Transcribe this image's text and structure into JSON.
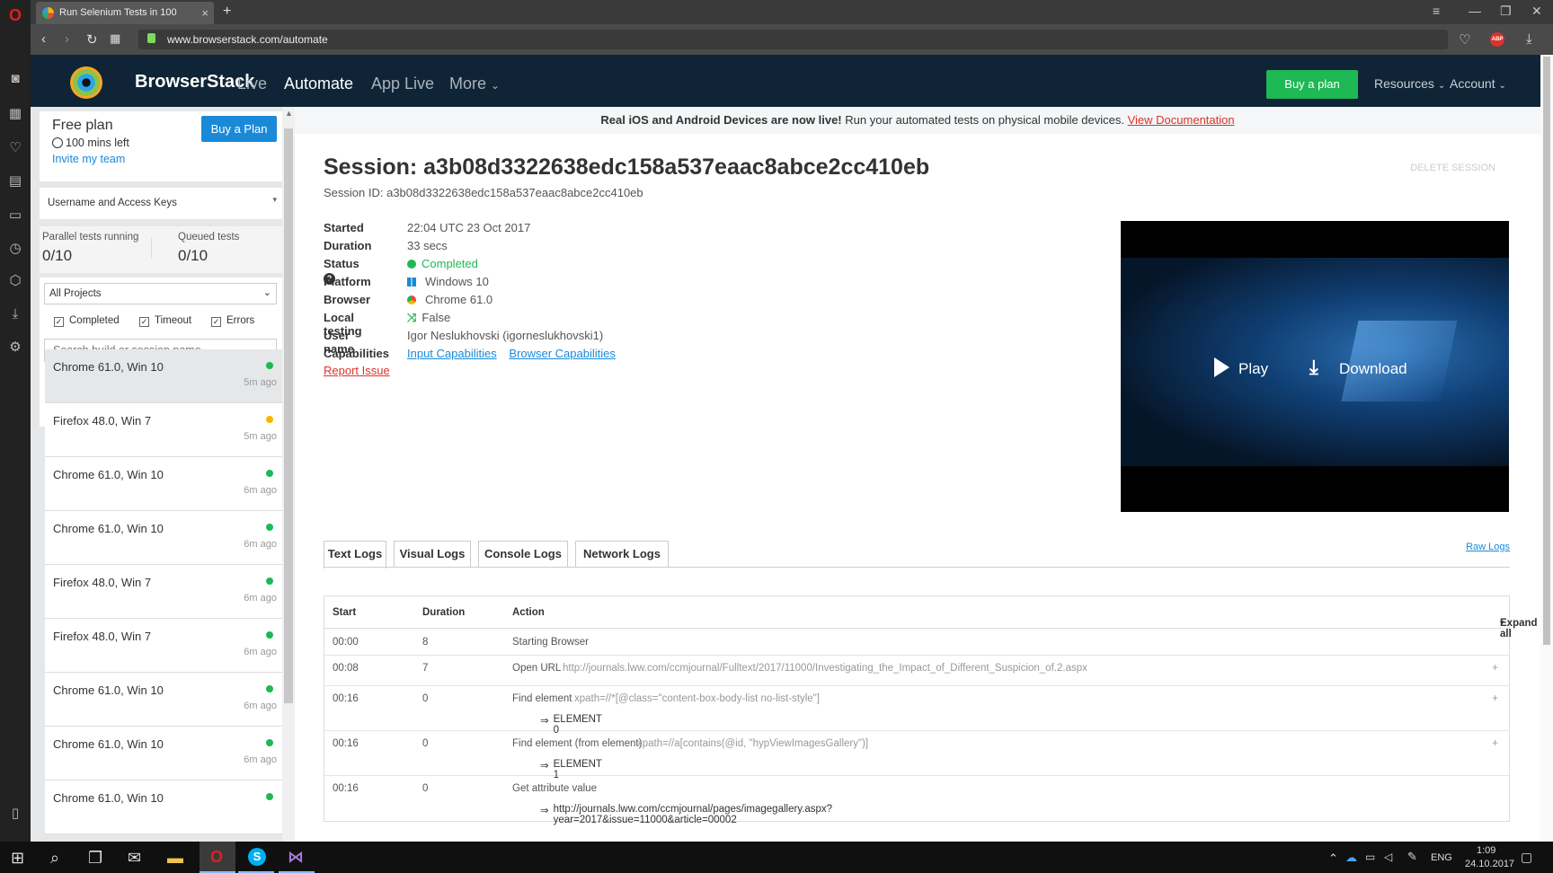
{
  "browser": {
    "tab_title": "Run Selenium Tests in 100",
    "tab_close": "×",
    "new_tab": "+",
    "url": "www.browserstack.com/automate",
    "adblock_badge": "ABP"
  },
  "site_nav": {
    "brand": "BrowserStack",
    "links": [
      "Live",
      "Automate",
      "App Live",
      "More"
    ],
    "more_chevron": "⌄",
    "buy_plan": "Buy a plan",
    "resources": "Resources",
    "account": "Account"
  },
  "sidebar": {
    "plan": {
      "title": "Free plan",
      "mins_left": "100 mins left",
      "invite": "Invite my team",
      "buy_button": "Buy a Plan"
    },
    "access_keys_label": "Username and Access Keys",
    "parallel": {
      "label": "Parallel tests running",
      "value": "0/10"
    },
    "queued": {
      "label": "Queued tests",
      "value": "0/10"
    },
    "project_filter": "All Projects",
    "filters": [
      "Completed",
      "Timeout",
      "Errors"
    ],
    "search_placeholder": "Search build or session name",
    "sessions": [
      {
        "name": "Chrome 61.0, Win 10",
        "time": "5m ago",
        "status_color": "#1eb854"
      },
      {
        "name": "Firefox 48.0, Win 7",
        "time": "5m ago",
        "status_color": "#f5b800"
      },
      {
        "name": "Chrome 61.0, Win 10",
        "time": "6m ago",
        "status_color": "#1eb854"
      },
      {
        "name": "Chrome 61.0, Win 10",
        "time": "6m ago",
        "status_color": "#1eb854"
      },
      {
        "name": "Firefox 48.0, Win 7",
        "time": "6m ago",
        "status_color": "#1eb854"
      },
      {
        "name": "Firefox 48.0, Win 7",
        "time": "6m ago",
        "status_color": "#1eb854"
      },
      {
        "name": "Chrome 61.0, Win 10",
        "time": "6m ago",
        "status_color": "#1eb854"
      },
      {
        "name": "Chrome 61.0, Win 10",
        "time": "6m ago",
        "status_color": "#1eb854"
      },
      {
        "name": "Chrome 61.0, Win 10",
        "time": "",
        "status_color": "#1eb854"
      }
    ]
  },
  "banner": {
    "bold": "Real iOS and Android Devices are now live!",
    "text": "Run your automated tests on physical mobile devices.",
    "link": "View Documentation"
  },
  "session": {
    "title": "Session: a3b08d3322638edc158a537eaac8abce2cc410eb",
    "id_line": "Session ID: a3b08d3322638edc158a537eaac8abce2cc410eb",
    "delete": "DELETE SESSION",
    "rows": [
      {
        "key": "Started",
        "value": "22:04 UTC 23 Oct 2017"
      },
      {
        "key": "Duration",
        "value": "33 secs"
      },
      {
        "key": "Status",
        "value": "Completed"
      },
      {
        "key": "Platform",
        "value": "Windows 10"
      },
      {
        "key": "Browser",
        "value": "Chrome 61.0"
      },
      {
        "key": "Local testing",
        "value": "False"
      },
      {
        "key": "User name",
        "value": "Igor Neslukhovski (igorneslukhovski1)"
      },
      {
        "key": "Capabilities",
        "value": ""
      }
    ],
    "capabilities": [
      "Input Capabilities",
      "Browser Capabilities"
    ],
    "report_issue": "Report Issue"
  },
  "video": {
    "play": "Play",
    "download": "Download"
  },
  "logs": {
    "tabs": [
      "Text Logs",
      "Visual Logs",
      "Console Logs",
      "Network Logs"
    ],
    "raw_logs": "Raw Logs",
    "headers": {
      "start": "Start",
      "duration": "Duration",
      "action": "Action",
      "expand": "Expand all"
    },
    "rows": [
      {
        "start": "00:00",
        "duration": "8",
        "action": "Starting Browser",
        "extra": "",
        "sub": ""
      },
      {
        "start": "00:08",
        "duration": "7",
        "action": "Open URL",
        "extra": "http://journals.lww.com/ccmjournal/Fulltext/2017/11000/Investigating_the_Impact_of_Different_Suspicion_of.2.aspx",
        "sub": ""
      },
      {
        "start": "00:16",
        "duration": "0",
        "action": "Find element",
        "extra": "xpath=//*[@class=\"content-box-body-list no-list-style\"]",
        "sub": "ELEMENT 0"
      },
      {
        "start": "00:16",
        "duration": "0",
        "action": "Find element (from element)",
        "extra": "xpath=//a[contains(@id, \"hypViewImagesGallery\")]",
        "sub": "ELEMENT 1"
      },
      {
        "start": "00:16",
        "duration": "0",
        "action": "Get attribute value",
        "extra": "",
        "sub": "http://journals.lww.com/ccmjournal/pages/imagegallery.aspx?year=2017&issue=11000&article=00002"
      }
    ]
  },
  "taskbar": {
    "lang": "ENG",
    "time": "1:09",
    "date": "24.10.2017"
  },
  "colors": {
    "nav_bg": "#0f2537",
    "green": "#1eb854",
    "blue": "#1a8ad8",
    "red_link": "#d9342b"
  }
}
